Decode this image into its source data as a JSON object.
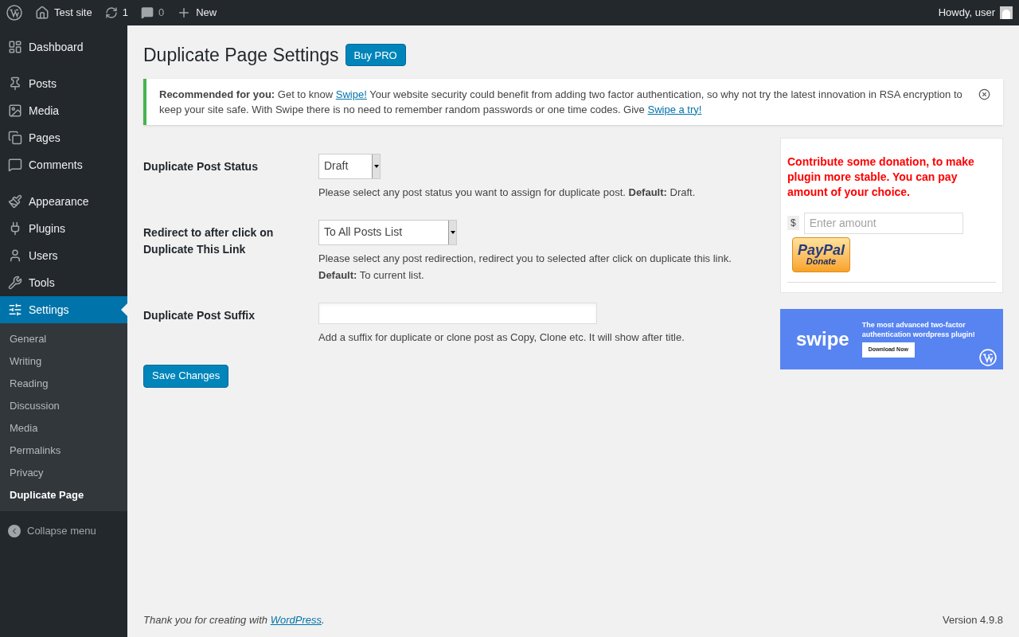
{
  "admin_bar": {
    "site": "Test site",
    "updates": "1",
    "comments": "0",
    "new": "New",
    "greeting": "Howdy, user"
  },
  "sidebar": {
    "items": [
      {
        "label": "Dashboard",
        "selected": false
      },
      {
        "label": "Posts",
        "selected": false
      },
      {
        "label": "Media",
        "selected": false
      },
      {
        "label": "Pages",
        "selected": false
      },
      {
        "label": "Comments",
        "selected": false
      },
      {
        "label": "Appearance",
        "selected": false
      },
      {
        "label": "Plugins",
        "selected": false
      },
      {
        "label": "Users",
        "selected": false
      },
      {
        "label": "Tools",
        "selected": false
      },
      {
        "label": "Settings",
        "selected": true
      }
    ],
    "submenu": [
      {
        "label": "General",
        "selected": false
      },
      {
        "label": "Writing",
        "selected": false
      },
      {
        "label": "Reading",
        "selected": false
      },
      {
        "label": "Discussion",
        "selected": false
      },
      {
        "label": "Media",
        "selected": false
      },
      {
        "label": "Permalinks",
        "selected": false
      },
      {
        "label": "Privacy",
        "selected": false
      },
      {
        "label": "Duplicate Page",
        "selected": true
      }
    ],
    "collapse": "Collapse menu"
  },
  "page": {
    "title": "Duplicate Page Settings",
    "pro_button": "Buy PRO"
  },
  "notice": {
    "label": "Recommended for you:",
    "text_1": " Get to know ",
    "link_1": "Swipe!",
    "text_2": " Your website security could benefit from adding two factor authentication, so why not try the latest innovation in RSA encryption to keep your site safe. With Swipe there is no need to remember random passwords or one time codes. Give ",
    "link_2": "Swipe a try!"
  },
  "fields": [
    {
      "kind": "select",
      "label": "Duplicate Post Status",
      "value": "Draft",
      "help": "Please select any post status you want to assign for duplicate post. **Default:** Draft."
    },
    {
      "kind": "select",
      "label": "Redirect to after click on Duplicate This Link",
      "value": "To All Posts List",
      "help": "Please select any post redirection, redirect you to selected after click on duplicate this link. **Default:** To current list."
    },
    {
      "kind": "text",
      "label": "Duplicate Post Suffix",
      "help": "Add a suffix for duplicate or clone post as Copy, Clone etc. It will show after title."
    }
  ],
  "save_button": "Save Changes",
  "donation": {
    "message": "Contribute some donation, to make plugin more stable. You can pay amount of your choice.",
    "currency": "$",
    "placeholder": "Enter amount",
    "paypal": "PayPal",
    "donate": "Donate"
  },
  "banner": {
    "brand": "swipe",
    "tagline": "The most advanced two-factor authentication wordpress plugin!",
    "button": "Download Now"
  },
  "footer": {
    "text": "Thank you for creating with ",
    "link": "WordPress",
    "text_end": ".",
    "version": "Version 4.9.8"
  }
}
